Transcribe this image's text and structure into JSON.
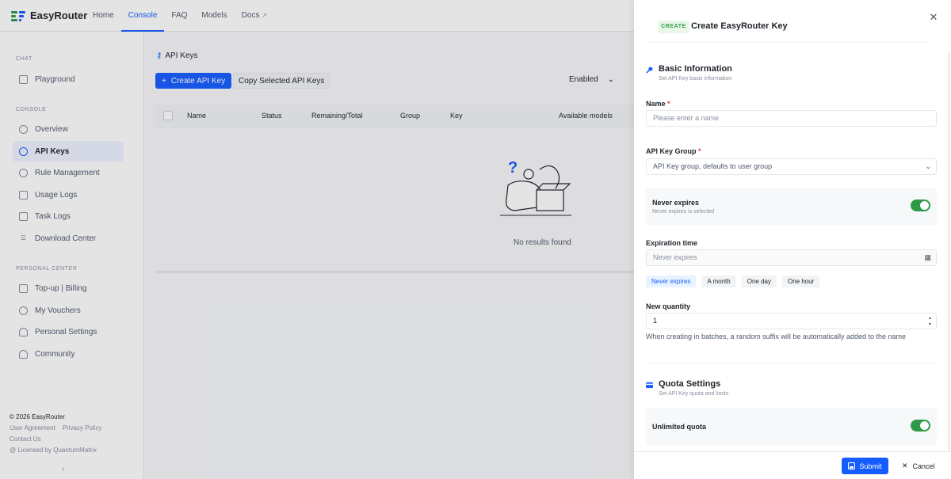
{
  "brand": {
    "name": "EasyRouter"
  },
  "nav": {
    "items": [
      {
        "label": "Home"
      },
      {
        "label": "Console"
      },
      {
        "label": "FAQ"
      },
      {
        "label": "Models"
      },
      {
        "label": "Docs"
      }
    ],
    "active": "Console"
  },
  "sidebar": {
    "chat_label": "CHAT",
    "chat_items": [
      {
        "label": "Playground"
      }
    ],
    "console_label": "CONSOLE",
    "console_items": [
      {
        "label": "Overview"
      },
      {
        "label": "API Keys"
      },
      {
        "label": "Rule Management"
      },
      {
        "label": "Usage Logs"
      },
      {
        "label": "Task Logs"
      },
      {
        "label": "Download Center"
      }
    ],
    "personal_label": "PERSONAL CENTER",
    "personal_items": [
      {
        "label": "Top-up | Billing"
      },
      {
        "label": "My Vouchers"
      },
      {
        "label": "Personal Settings"
      },
      {
        "label": "Community"
      }
    ],
    "footer": {
      "copyright": "© 2026 EasyRouter",
      "user_agreement": "User Agreement",
      "privacy_policy": "Privacy Policy",
      "contact": "Contact Us",
      "licensed": "@ Licensed by QuantumMatrix"
    },
    "collapse_glyph": "‹"
  },
  "main": {
    "breadcrumb": "API Keys",
    "create_button": "Create API Key",
    "copy_button": "Copy Selected API Keys",
    "filter_value": "Enabled",
    "table_headers": [
      "Name",
      "Status",
      "Remaining/Total",
      "Group",
      "Key",
      "Available models"
    ],
    "empty_text": "No results found"
  },
  "drawer": {
    "tag": "CREATE",
    "title": "Create EasyRouter Key",
    "basic": {
      "title": "Basic Information",
      "subtitle": "Set API Key basic information"
    },
    "name_field": {
      "label": "Name",
      "required_mark": "*",
      "placeholder": "Please enter a name"
    },
    "group_field": {
      "label": "API Key Group",
      "required_mark": "*",
      "placeholder": "API Key group, defaults to user group"
    },
    "never_expires": {
      "title": "Never expires",
      "subtitle": "Never expires is selected",
      "enabled": true
    },
    "expiration": {
      "label": "Expiration time",
      "placeholder": "Never expires",
      "options": [
        "Never expires",
        "A month",
        "One day",
        "One hour"
      ],
      "selected": "Never expires"
    },
    "quantity": {
      "label": "New quantity",
      "value": "1",
      "help": "When creating in batches, a random suffix will be automatically added to the name"
    },
    "quota": {
      "title": "Quota Settings",
      "subtitle": "Set API Key quota and limits"
    },
    "unlimited_quota": {
      "title": "Unlimited quota",
      "enabled": true
    },
    "submit_label": "Submit",
    "cancel_label": "Cancel"
  },
  "colors": {
    "primary": "#165dff",
    "success": "#2e9a48",
    "danger": "#f53f3f"
  }
}
